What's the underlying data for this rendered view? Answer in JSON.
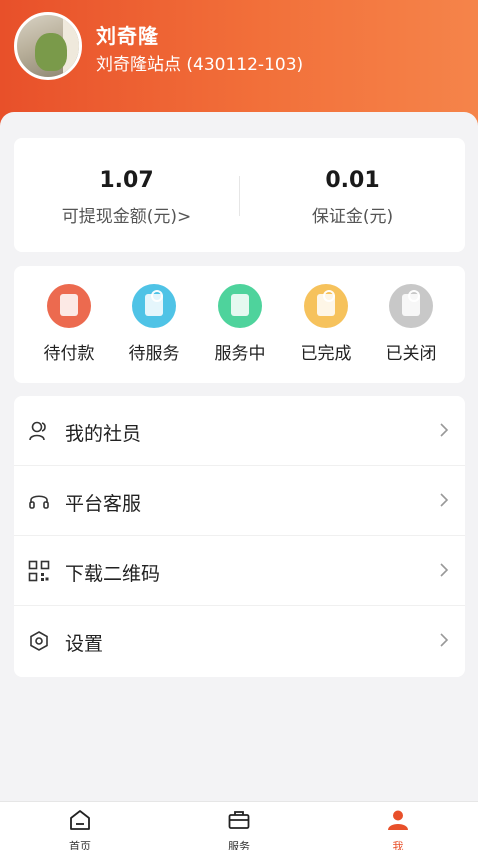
{
  "profile": {
    "name": "刘奇隆",
    "station": "刘奇隆站点 (430112-103)"
  },
  "balance": {
    "withdrawable_value": "1.07",
    "withdrawable_label": "可提现金额(元)>",
    "deposit_value": "0.01",
    "deposit_label": "保证金(元)"
  },
  "orders": [
    {
      "label": "待付款",
      "icon": "wallet-icon",
      "color": "#ec6a4f"
    },
    {
      "label": "待服务",
      "icon": "clock-doc-icon",
      "color": "#4fc3e6"
    },
    {
      "label": "服务中",
      "icon": "chat-doc-icon",
      "color": "#4ed39c"
    },
    {
      "label": "已完成",
      "icon": "check-doc-icon",
      "color": "#f6c25c"
    },
    {
      "label": "已关闭",
      "icon": "close-doc-icon",
      "color": "#c8c8c8"
    }
  ],
  "menu": [
    {
      "label": "我的社员",
      "icon": "members-icon"
    },
    {
      "label": "平台客服",
      "icon": "headset-icon"
    },
    {
      "label": "下载二维码",
      "icon": "qrcode-icon"
    },
    {
      "label": "设置",
      "icon": "settings-hex-icon"
    }
  ],
  "tabbar": [
    {
      "label": "首页",
      "icon": "home-icon"
    },
    {
      "label": "服务",
      "icon": "briefcase-icon"
    },
    {
      "label": "我",
      "icon": "profile-icon",
      "active": true
    }
  ],
  "colors": {
    "accent": "#e8502a",
    "background": "#f3f3f5"
  }
}
